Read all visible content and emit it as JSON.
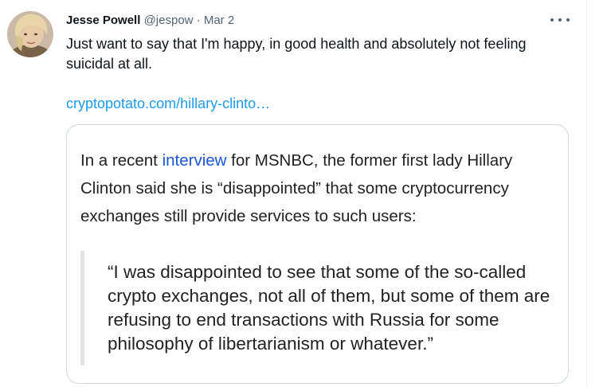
{
  "author": {
    "display_name": "Jesse Powell",
    "handle": "@jespow",
    "separator": "·",
    "date": "Mar 2"
  },
  "tweet": {
    "text": "Just want to say that I'm happy, in good health and absolutely not feeling suicidal at all.",
    "link_text": "cryptopotato.com/hillary-clinto…"
  },
  "card": {
    "para_before": "In a recent ",
    "para_link": "interview",
    "para_after": " for MSNBC, the former first lady Hillary Clinton said she is “disappointed” that some cryptocurrency exchanges still provide services to such users:",
    "quote": "“I was disappointed to see that some of the so-called crypto exchanges, not all of them, but some of them are refusing to end transactions with Russia for some philosophy of libertarianism or whatever.”"
  },
  "icons": {
    "avatar": "user-avatar",
    "more": "more-icon"
  },
  "colors": {
    "link": "#1d9bf0",
    "secondary_text": "#536471",
    "card_border": "#cfd9de",
    "inline_link": "#1a57d6"
  }
}
